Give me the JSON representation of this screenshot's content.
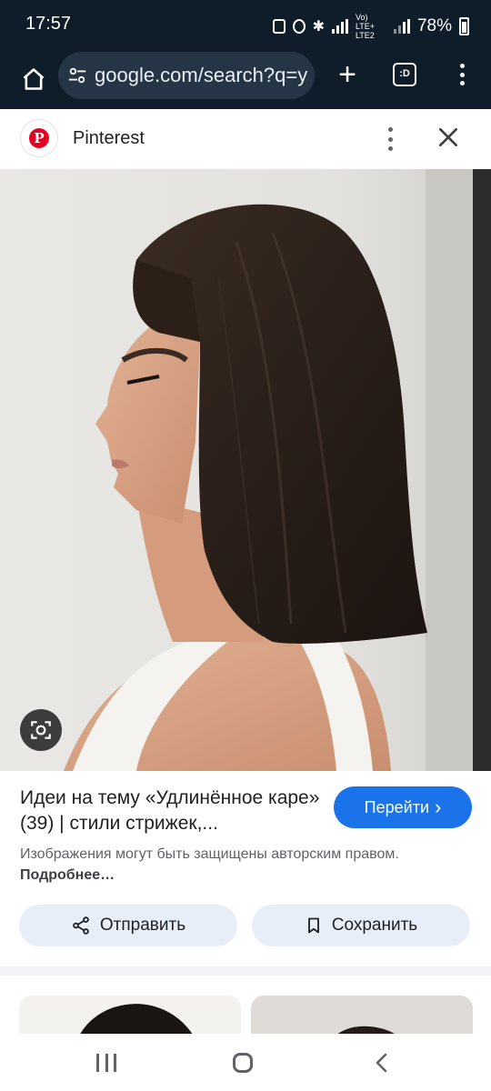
{
  "status_bar": {
    "time": "17:57",
    "network": "Vo) LTE+ LTE2",
    "battery": "78%"
  },
  "browser": {
    "url": "google.com/search?q=y",
    "plus_icon": "plus-icon",
    "tabs_label": ":D"
  },
  "source": {
    "name": "Pinterest",
    "logo_letter": "P",
    "brand_color": "#e60023"
  },
  "result": {
    "title": "Идеи на тему «Удлинённое каре» (39) | стили стрижек,...",
    "goto_label": "Перейти",
    "goto_arrow": "›",
    "copyright_text": "Изображения могут быть защищены авторским правом.",
    "more_label": "Подробнее…",
    "share_label": "Отправить",
    "save_label": "Сохранить",
    "accent_color": "#1a73e8"
  }
}
